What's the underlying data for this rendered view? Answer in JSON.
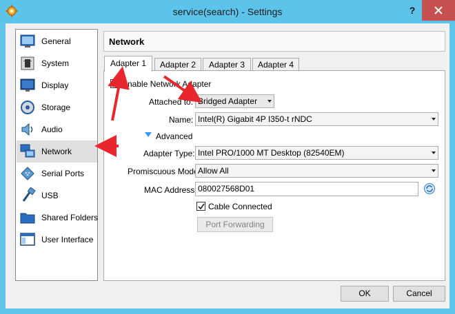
{
  "window": {
    "title": "service(search) - Settings",
    "help_label": "?"
  },
  "sidebar": {
    "items": [
      {
        "label": "General",
        "icon": "general-icon"
      },
      {
        "label": "System",
        "icon": "system-icon"
      },
      {
        "label": "Display",
        "icon": "display-icon"
      },
      {
        "label": "Storage",
        "icon": "storage-icon"
      },
      {
        "label": "Audio",
        "icon": "audio-icon"
      },
      {
        "label": "Network",
        "icon": "network-icon",
        "selected": true
      },
      {
        "label": "Serial Ports",
        "icon": "serial-ports-icon"
      },
      {
        "label": "USB",
        "icon": "usb-icon"
      },
      {
        "label": "Shared Folders",
        "icon": "shared-folders-icon"
      },
      {
        "label": "User Interface",
        "icon": "user-interface-icon"
      }
    ]
  },
  "page": {
    "title": "Network"
  },
  "tabs": [
    "Adapter 1",
    "Adapter 2",
    "Adapter 3",
    "Adapter 4"
  ],
  "adapter": {
    "enable_label": "Enable Network Adapter",
    "enabled": true,
    "attached_label": "Attached to:",
    "attached_value": "Bridged Adapter",
    "name_label": "Name:",
    "name_value": "Intel(R) Gigabit 4P I350-t rNDC",
    "advanced_label": "Advanced",
    "type_label": "Adapter Type:",
    "type_value": "Intel PRO/1000 MT Desktop (82540EM)",
    "promisc_label": "Promiscuous Mode:",
    "promisc_value": "Allow All",
    "mac_label": "MAC Address:",
    "mac_value": "080027568D01",
    "cable_label": "Cable Connected",
    "cable_connected": true,
    "port_forwarding_label": "Port Forwarding"
  },
  "buttons": {
    "ok": "OK",
    "cancel": "Cancel"
  },
  "colors": {
    "titlebar": "#5cc4ea",
    "close": "#c75050",
    "annotation_arrow": "#e8262d",
    "accent": "#3399ff"
  }
}
